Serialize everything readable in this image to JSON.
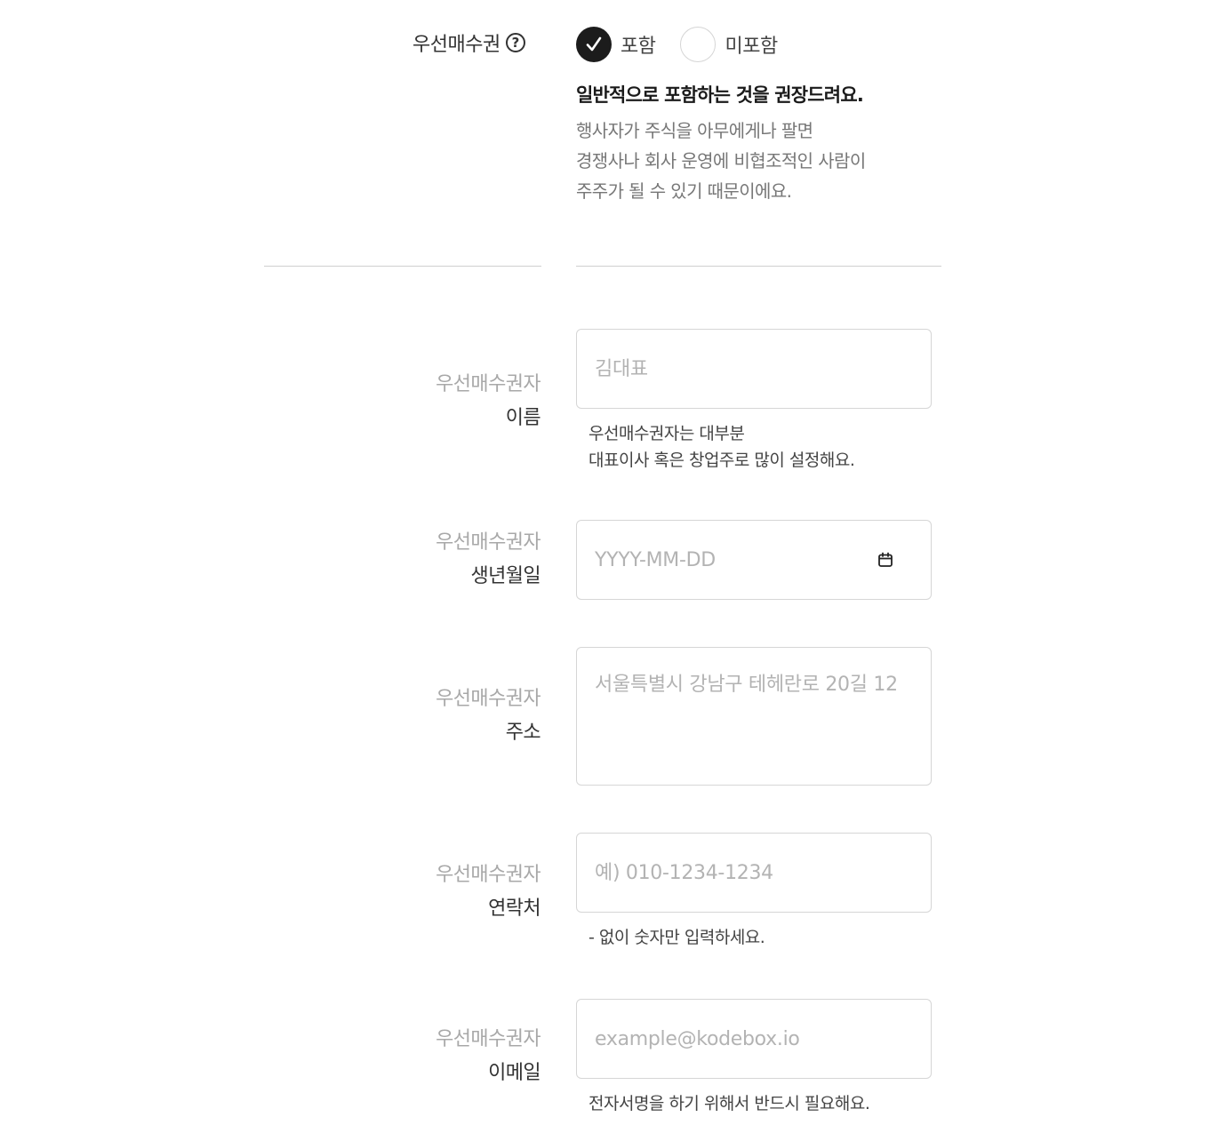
{
  "preemptive": {
    "label": "우선매수권",
    "help_symbol": "?",
    "options": [
      {
        "label": "포함",
        "checked": true
      },
      {
        "label": "미포함",
        "checked": false
      }
    ],
    "notice_title": "일반적으로 포함하는 것을 권장드려요.",
    "notice_lines": [
      "행사자가 주식을 아무에게나 팔면",
      "경쟁사나 회사 운영에 비협조적인 사람이",
      "주주가 될 수 있기 때문이에요."
    ]
  },
  "fields": {
    "name": {
      "label_line1": "우선매수권자",
      "label_line2": "이름",
      "placeholder": "김대표",
      "hint_lines": [
        "우선매수권자는 대부분",
        "대표이사 혹은 창업주로 많이 설정해요."
      ]
    },
    "birth": {
      "label_line1": "우선매수권자",
      "label_line2": "생년월일",
      "placeholder": "YYYY-MM-DD",
      "icon": "calendar-icon"
    },
    "address": {
      "label_line1": "우선매수권자",
      "label_line2": "주소",
      "placeholder": "서울특별시 강남구 테헤란로 20길 12"
    },
    "phone": {
      "label_line1": "우선매수권자",
      "label_line2": "연락처",
      "placeholder": "예) 010-1234-1234",
      "hint": "- 없이 숫자만 입력하세요."
    },
    "email": {
      "label_line1": "우선매수권자",
      "label_line2": "이메일",
      "placeholder": "example@kodebox.io",
      "hint": "전자서명을 하기 위해서 반드시 필요해요."
    }
  },
  "colors": {
    "checked_radio": "#1c1c1c",
    "label_muted": "#a8a8a8",
    "field_border": "#d6d6d6",
    "placeholder": "#b3b3b3"
  }
}
